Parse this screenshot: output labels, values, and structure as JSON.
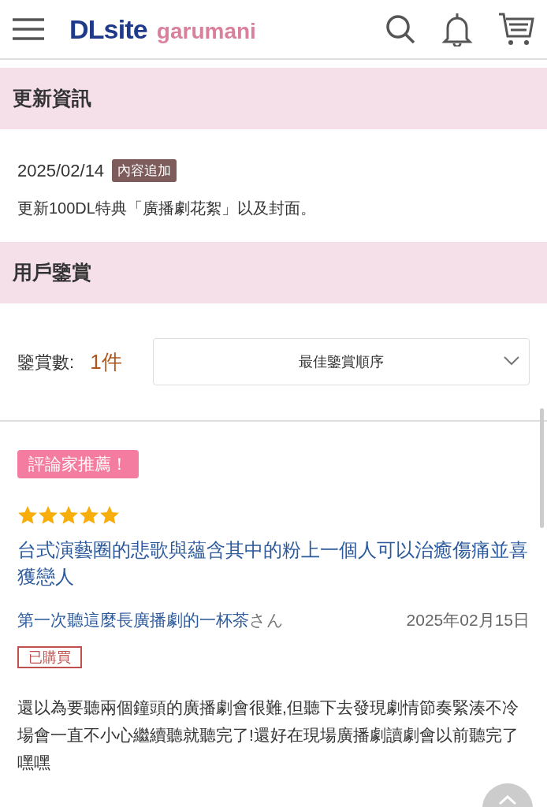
{
  "header": {
    "logo": {
      "brand": "DLsite",
      "sub": "garumani"
    }
  },
  "updates": {
    "heading": "更新資訊",
    "entries": [
      {
        "date": "2025/02/14",
        "tag": "內容追加",
        "text": "更新100DL特典「廣播劇花絮」以及封面。"
      }
    ]
  },
  "reviews": {
    "heading": "用戶鑒賞",
    "count_label": "鑒賞數:",
    "count": "1件",
    "sort": {
      "value": "最佳鑒賞順序"
    },
    "items": [
      {
        "badge": "評論家推薦！",
        "stars": 5,
        "title": "台式演藝圈的悲歌與蘊含其中的粉上一個人可以治癒傷痛並喜獲戀人",
        "author": "第一次聽這麼長廣播劇的一杯茶",
        "author_suffix": "さん",
        "date": "2025年02月15日",
        "purchased": true,
        "purchased_label": "已購買",
        "body": "還以為要聽兩個鐘頭的廣播劇會很難,但聽下去發現劇情節奏緊湊不冷場會一直不小心繼續聽就聽完了!還好在現場廣播劇讀劇會以前聽完了嘿嘿"
      }
    ]
  }
}
